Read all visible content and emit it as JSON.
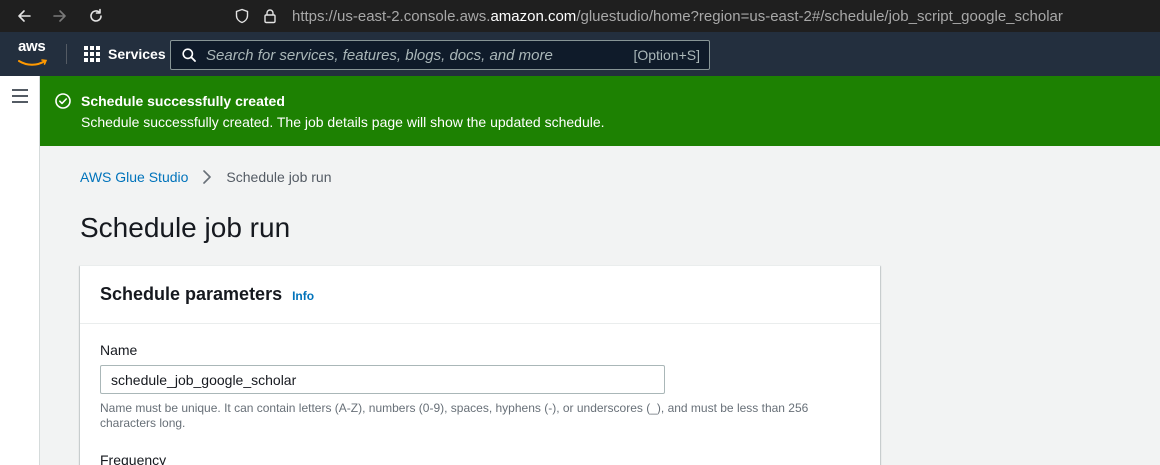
{
  "browser": {
    "url_prefix": "https://us-east-2.console.aws.",
    "url_domain": "amazon.com",
    "url_suffix": "/gluestudio/home?region=us-east-2#/schedule/job_script_google_scholar"
  },
  "aws_nav": {
    "logo_text": "aws",
    "services_label": "Services",
    "search_placeholder": "Search for services, features, blogs, docs, and more",
    "search_shortcut": "[Option+S]"
  },
  "flash": {
    "title": "Schedule successfully created",
    "message": "Schedule successfully created. The job details page will show the updated schedule.",
    "color": "#1d8102"
  },
  "breadcrumb": {
    "root": "AWS Glue Studio",
    "current": "Schedule job run"
  },
  "page": {
    "title": "Schedule job run"
  },
  "panel": {
    "title": "Schedule parameters",
    "info_label": "Info",
    "name_label": "Name",
    "name_value": "schedule_job_google_scholar",
    "name_hint": "Name must be unique. It can contain letters (A-Z), numbers (0-9), spaces, hyphens (-), or underscores (_), and must be less than 256 characters long.",
    "frequency_label": "Frequency"
  },
  "colors": {
    "aws_nav_bg": "#232f3e",
    "link": "#0073bb",
    "success": "#1d8102"
  }
}
